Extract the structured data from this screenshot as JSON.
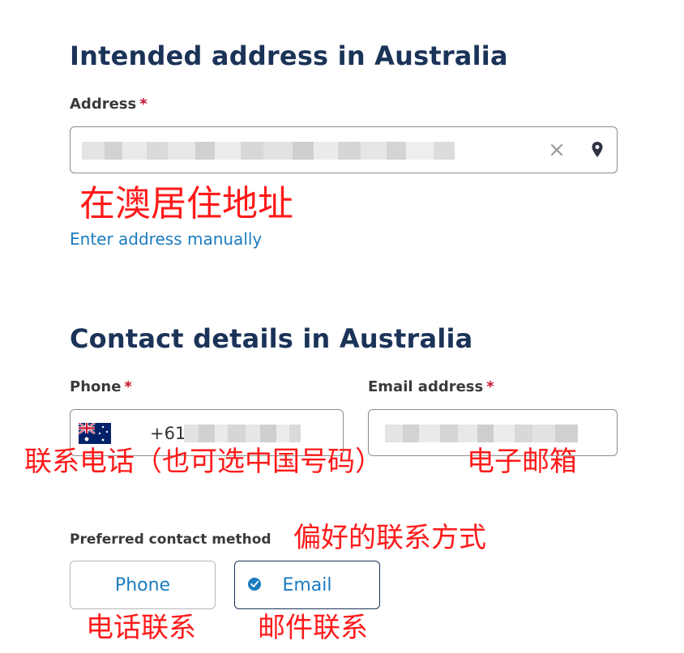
{
  "address_section": {
    "heading": "Intended address in Australia",
    "address_label": "Address",
    "required_mark": "*",
    "clear_icon": "close-icon",
    "location_icon": "map-pin-icon",
    "manual_link": "Enter address manually",
    "annotation": "在澳居住地址"
  },
  "contact_section": {
    "heading": "Contact details in Australia",
    "phone_label": "Phone",
    "phone_required_mark": "*",
    "country_flag_icon": "australia-flag-icon",
    "phone_prefix": "+61",
    "phone_annotation": "联系电话（也可选中国号码）",
    "email_label": "Email address",
    "email_required_mark": "*",
    "email_annotation": "电子邮箱"
  },
  "preferred_method": {
    "label": "Preferred contact method",
    "annotation": "偏好的联系方式",
    "options": [
      {
        "label": "Phone",
        "selected": false,
        "annotation": "电话联系"
      },
      {
        "label": "Email",
        "selected": true,
        "annotation": "邮件联系"
      }
    ]
  },
  "colors": {
    "heading": "#1b3358",
    "link": "#1c7bbf",
    "required": "#c8102e",
    "annotation": "#ff1a1a"
  }
}
